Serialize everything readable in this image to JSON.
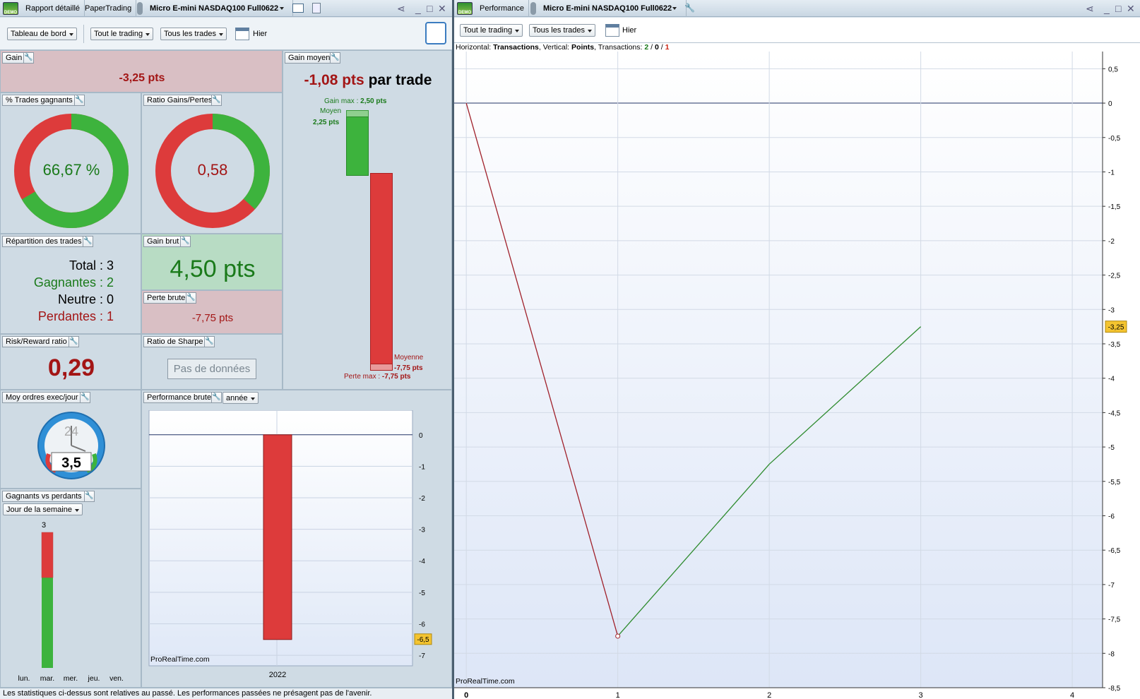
{
  "left_window": {
    "title_tabs": [
      "Rapport détaillé",
      "PaperTrading",
      "Micro E-mini NASDAQ100 Full0622"
    ],
    "demo_badge": "DEMO",
    "toolbar": {
      "dashboard": "Tableau de bord",
      "scope": "Tout le trading",
      "trades": "Tous les trades",
      "period": "Hier"
    }
  },
  "panels": {
    "gain": {
      "label": "Gain",
      "value": "-3,25 pts"
    },
    "gain_moyen": {
      "label": "Gain moyen",
      "value": "-1,08 pts",
      "suffix": "par trade",
      "gain_max_label": "Gain max :",
      "gain_max": "2,50 pts",
      "moyen_label": "Moyen",
      "moyen_value": "2,25 pts",
      "moyenne_label": "Moyenne",
      "moyenne_value": "-7,75 pts",
      "perte_max_label": "Perte max :",
      "perte_max": "-7,75 pts"
    },
    "pct_trades_gagnants": {
      "label": "% Trades gagnants",
      "value": "66,67 %",
      "fraction": 0.6667
    },
    "ratio_gains_pertes": {
      "label": "Ratio Gains/Pertes",
      "value": "0,58",
      "fraction": 0.3671
    },
    "repartition": {
      "label": "Répartition des trades",
      "total": "Total : 3",
      "gagnantes": "Gagnantes : 2",
      "neutre": "Neutre : 0",
      "perdantes": "Perdantes : 1"
    },
    "gain_brut": {
      "label": "Gain brut",
      "value": "4,50 pts"
    },
    "perte_brute": {
      "label": "Perte brute",
      "value": "-7,75 pts"
    },
    "risk_reward": {
      "label": "Risk/Reward ratio",
      "value": "0,29"
    },
    "sharpe": {
      "label": "Ratio de Sharpe",
      "value": "Pas de données"
    },
    "moy_ordres": {
      "label": "Moy ordres exec/jour",
      "value": "3,5",
      "clock": "24"
    },
    "perf_brute": {
      "label": "Performance brute",
      "period": "année"
    },
    "gagnants_vs_perdants": {
      "label": "Gagnants vs perdants",
      "group": "Jour de la semaine",
      "top_value": "3"
    }
  },
  "status_text": "Les statistiques ci-dessus sont relatives au passé. Les performances passées ne présagent pas de l'avenir.",
  "right_window": {
    "title_tabs": [
      "Performance",
      "Micro E-mini NASDAQ100 Full0622"
    ],
    "demo_badge": "DEMO",
    "toolbar": {
      "scope": "Tout le trading",
      "trades": "Tous les trades",
      "period": "Hier"
    },
    "legend": {
      "h_label": "Horizontal:",
      "h_value": "Transactions",
      "v_label": "Vertical:",
      "v_value": "Points",
      "t_label": "Transactions:",
      "t_win": "2",
      "t_neutral": "0",
      "t_loss": "1"
    },
    "watermark": "ProRealTime.com"
  },
  "chart_data": [
    {
      "type": "bar",
      "categories": [
        "2022"
      ],
      "values": [
        -6.5
      ],
      "ylim": [
        -7.2,
        0.6
      ],
      "yticks": [
        0,
        -1,
        -2,
        -3,
        -4,
        -5,
        -6,
        -7
      ],
      "last_value_label": "-6,5",
      "watermark": "ProRealTime.com",
      "colors": {
        "bar": "#dd3b3b"
      }
    },
    {
      "type": "bar",
      "categories": [
        "lun.",
        "mar.",
        "mer.",
        "jeu.",
        "ven."
      ],
      "series": [
        {
          "name": "Gagnants",
          "values": [
            0,
            2,
            0,
            0,
            0
          ]
        },
        {
          "name": "Perdants",
          "values": [
            0,
            1,
            0,
            0,
            0
          ]
        }
      ],
      "colors": {
        "Gagnants": "#3db33d",
        "Perdants": "#dd3b3b"
      }
    },
    {
      "type": "line",
      "x": [
        0,
        1,
        2,
        3
      ],
      "y": [
        0,
        -7.75,
        -5.25,
        -3.25
      ],
      "xlim": [
        -0.08,
        4.2
      ],
      "ylim": [
        -8.5,
        0.75
      ],
      "xticks": [
        0,
        1,
        2,
        3,
        4
      ],
      "yticks": [
        0.5,
        0,
        -0.5,
        -1,
        -1.5,
        -2,
        -2.5,
        -3,
        -3.5,
        -4,
        -4.5,
        -5,
        -5.5,
        -6,
        -6.5,
        -7,
        -7.5,
        -8,
        -8.5
      ],
      "last_value_label": "-3,25",
      "colors": {
        "loss": "#a0202a",
        "gain": "#2e8b2e"
      }
    }
  ]
}
